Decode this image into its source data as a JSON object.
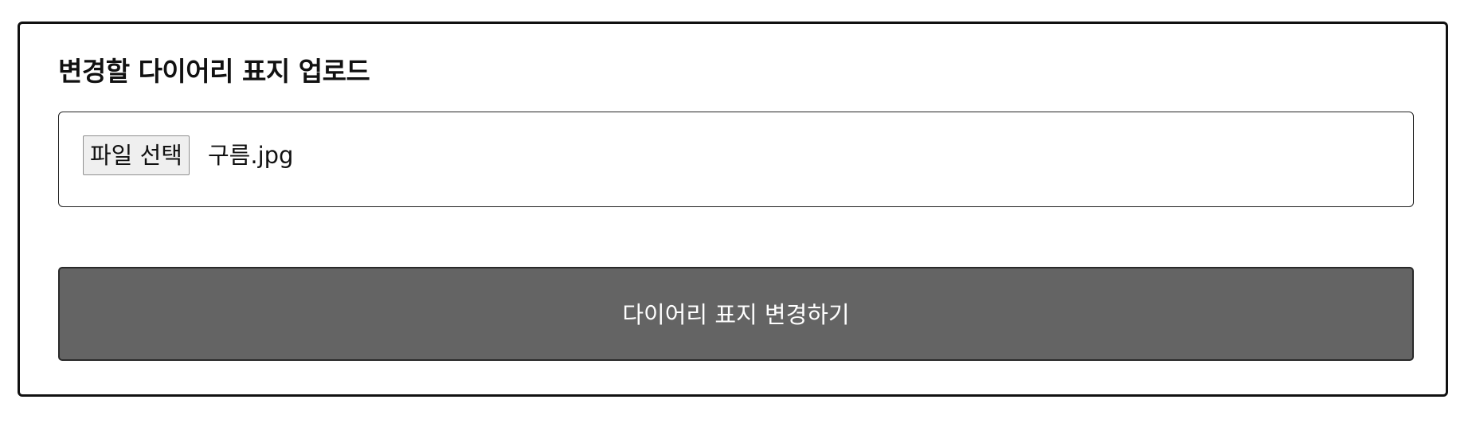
{
  "form": {
    "title": "변경할 다이어리 표지 업로드",
    "file_input": {
      "button_label": "파일 선택",
      "selected_file": "구름.jpg"
    },
    "submit_label": "다이어리 표지 변경하기"
  },
  "colors": {
    "card_border": "#111111",
    "submit_background": "#646464",
    "submit_text": "#ffffff",
    "file_button_background": "#efefef"
  }
}
